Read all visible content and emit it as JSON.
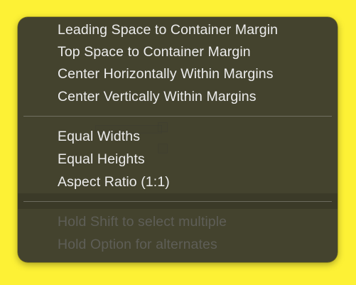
{
  "menu": {
    "sections": [
      {
        "items": [
          {
            "label": "Leading Space to Container Margin",
            "enabled": true
          },
          {
            "label": "Top Space to Container Margin",
            "enabled": true
          },
          {
            "label": "Center Horizontally Within Margins",
            "enabled": true
          },
          {
            "label": "Center Vertically Within Margins",
            "enabled": true
          }
        ]
      },
      {
        "items": [
          {
            "label": "Equal Widths",
            "enabled": true
          },
          {
            "label": "Equal Heights",
            "enabled": true
          },
          {
            "label": "Aspect Ratio (1:1)",
            "enabled": true
          }
        ]
      },
      {
        "items": [
          {
            "label": "Hold Shift to select multiple",
            "enabled": false
          },
          {
            "label": "Hold Option for alternates",
            "enabled": false
          }
        ]
      }
    ]
  },
  "colors": {
    "background": "#fdf135",
    "menu_background": "#34342e",
    "menu_text": "#ececec",
    "disabled_text": "#5e5e57"
  }
}
